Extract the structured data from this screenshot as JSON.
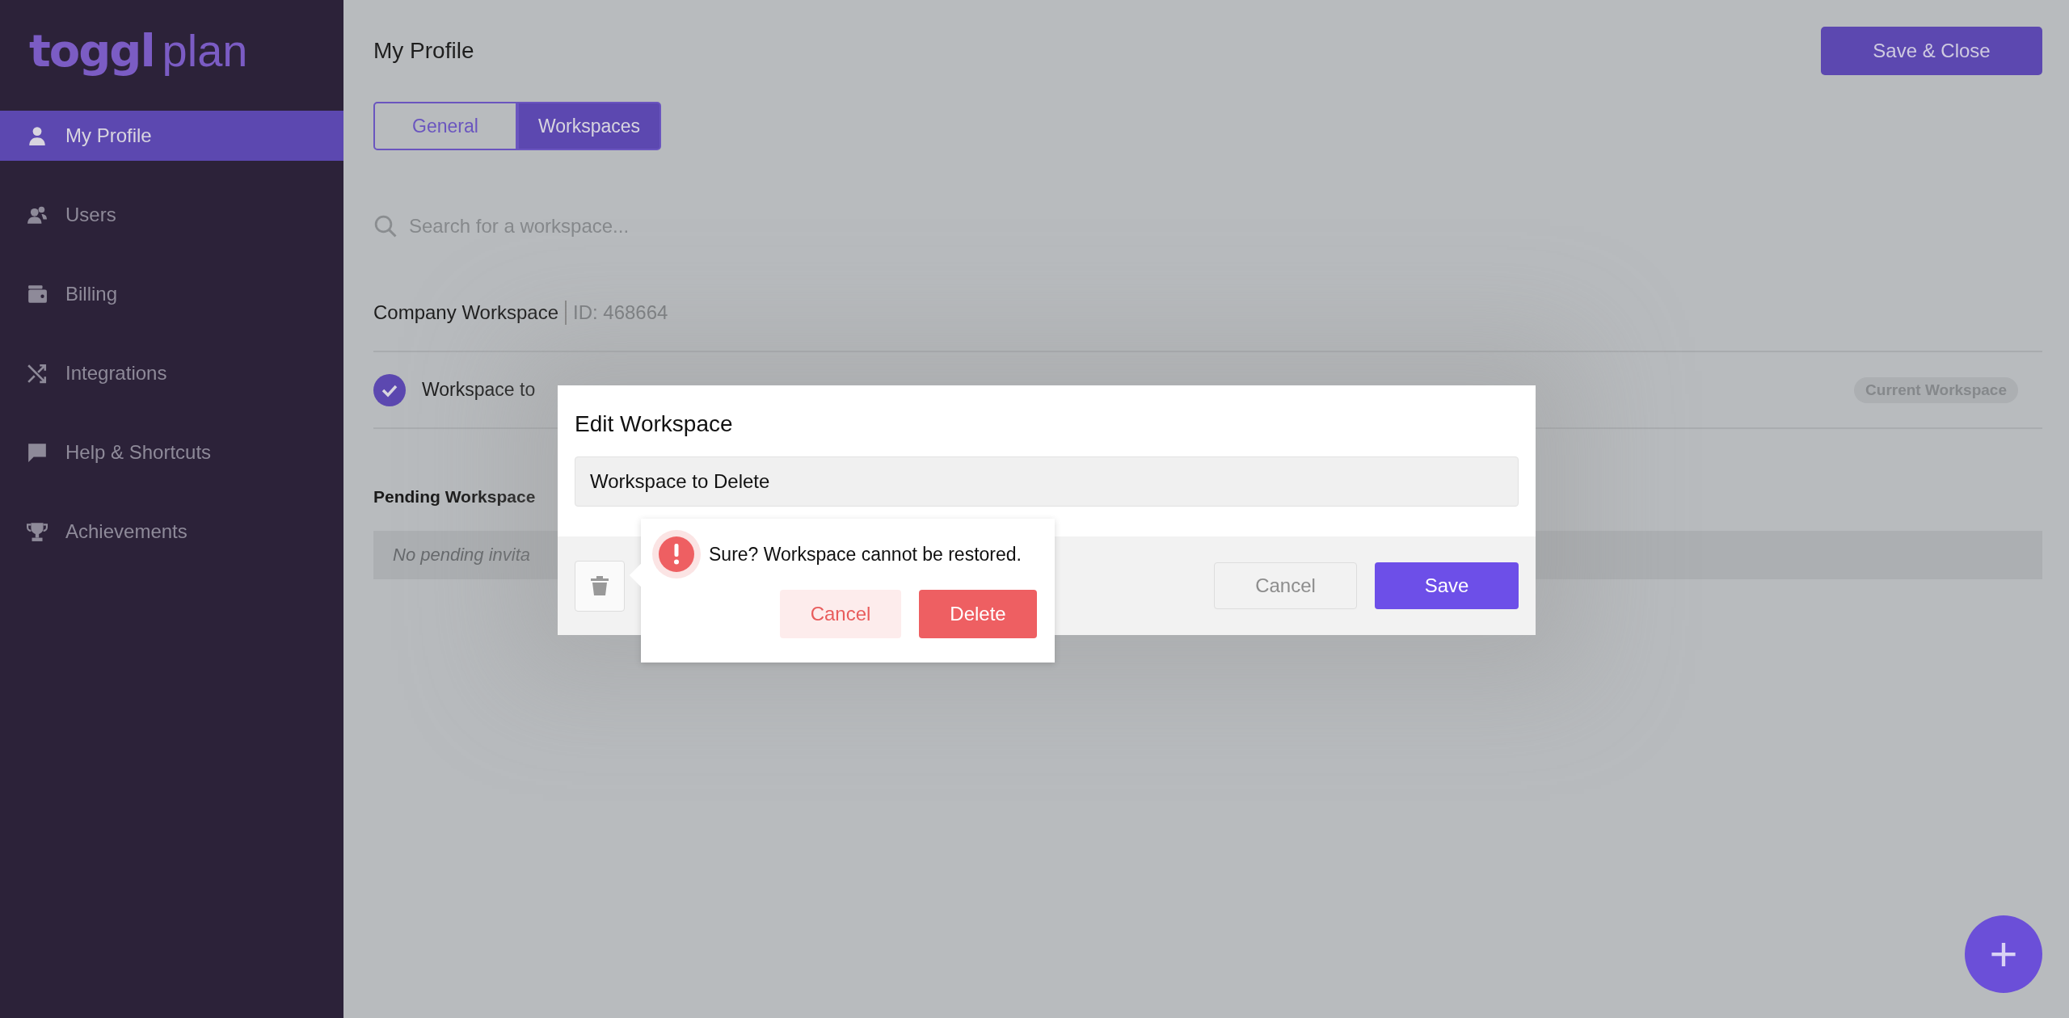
{
  "sidebar": {
    "logo": {
      "brand": "toggl",
      "product": "plan"
    },
    "items": [
      {
        "label": "My Profile",
        "kind": "person",
        "selected": true
      },
      {
        "label": "Users",
        "kind": "users",
        "selected": false
      },
      {
        "label": "Billing",
        "kind": "wallet",
        "selected": false
      },
      {
        "label": "Integrations",
        "kind": "shuffle",
        "selected": false
      },
      {
        "label": "Help & Shortcuts",
        "kind": "chat",
        "selected": false
      },
      {
        "label": "Achievements",
        "kind": "trophy",
        "selected": false
      }
    ]
  },
  "page": {
    "title": "My Profile",
    "save_button": "Save & Close",
    "tabs": [
      {
        "label": "General",
        "selected": false
      },
      {
        "label": "Workspaces",
        "selected": true
      }
    ],
    "search": {
      "placeholder": "Search for a workspace..."
    },
    "company": {
      "name": "Company Workspace",
      "id": "ID: 468664"
    },
    "workspaces": [
      {
        "name": "Workspace to",
        "current": true,
        "badge": "Current Workspace"
      }
    ],
    "pending": {
      "heading": "Pending Workspace",
      "empty": "No pending invita"
    }
  },
  "dialog": {
    "title": "Edit Workspace",
    "name_value": "Workspace to Delete",
    "cancel": "Cancel",
    "save": "Save",
    "confirm": {
      "message": "Sure? Workspace cannot be restored.",
      "cancel": "Cancel",
      "delete": "Delete"
    }
  },
  "fab": "+"
}
